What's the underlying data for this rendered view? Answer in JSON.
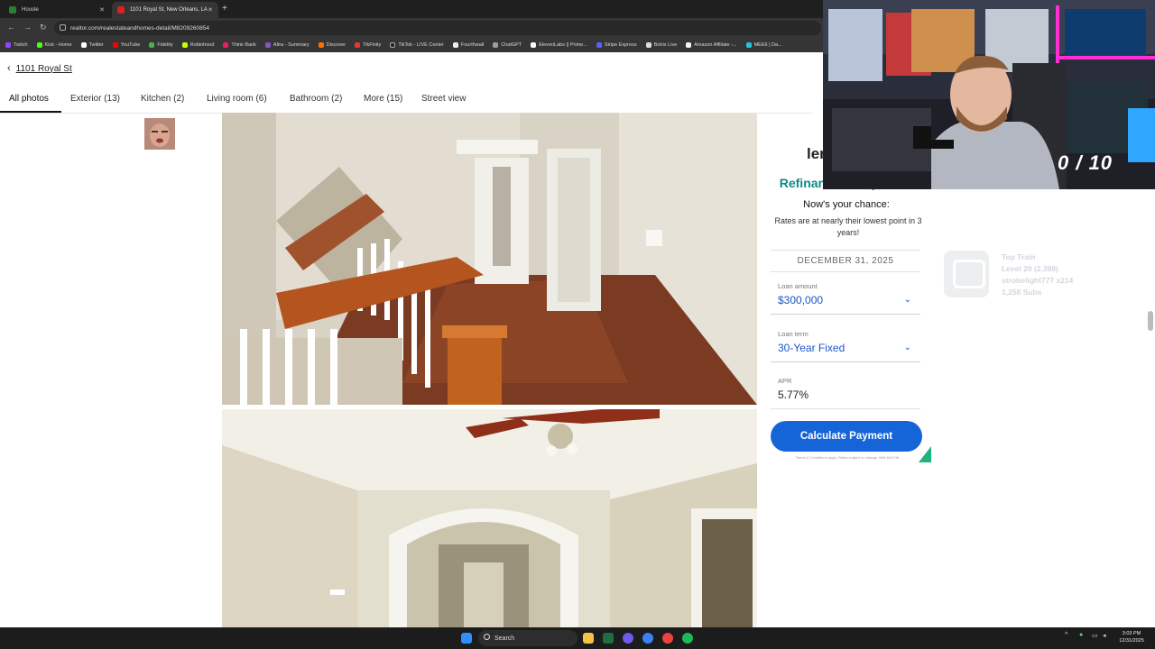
{
  "browser": {
    "tabs": [
      {
        "title": "Housle",
        "active": false
      },
      {
        "title": "1101 Royal St, New Orleans, LA",
        "active": true
      }
    ],
    "url": "realtor.com/realestateandhomes-detail/M8209260854",
    "bookmarks": [
      "Twitch",
      "Kick - Home",
      "Twitter",
      "YouTube",
      "Fidelity",
      "Robinhood",
      "Think Bank",
      "Altra - Summary",
      "Discover",
      "TikFinity",
      "TikTok - LIVE Center",
      "Fourthwall",
      "ChatGPT",
      "ElevenLabs || Prime...",
      "Stripe Express",
      "Botrix Live",
      "Amazon Affiliate -...",
      "MEE6 | Da..."
    ]
  },
  "listing": {
    "back_label": "1101 Royal St",
    "photo_tabs": [
      {
        "label": "All photos",
        "active": true
      },
      {
        "label": "Exterior (13)",
        "active": false
      },
      {
        "label": "Kitchen (2)",
        "active": false
      },
      {
        "label": "Living room (6)",
        "active": false
      },
      {
        "label": "Bathroom (2)",
        "active": false
      },
      {
        "label": "More (15)",
        "active": false
      },
      {
        "label": "Street view",
        "active": false
      }
    ]
  },
  "ad": {
    "brand": "len",
    "headline": "Refinance Comparison",
    "chance": "Now's your chance:",
    "rates_text": "Rates are at nearly their lowest point in 3 years!",
    "date": "DECEMBER 31, 2025",
    "loan_amount_label": "Loan amount",
    "loan_amount_value": "$300,000",
    "loan_term_label": "Loan term",
    "loan_term_value": "30-Year Fixed",
    "apr_label": "APR",
    "apr_value": "5.77%",
    "button_label": "Calculate Payment",
    "terms": "Terms & Conditions apply. Rates subject to change. NMLS#1136"
  },
  "stream": {
    "counter": "0 / 10",
    "top_train": {
      "title": "Top Train",
      "level": "Level 20  (2,398)",
      "user": "strobelight777 x214",
      "subs": "1,258 Subs"
    }
  },
  "taskbar": {
    "search_label": "Search",
    "time": "3:03 PM",
    "date": "12/31/2025"
  },
  "colors": {
    "accent_teal": "#0e8a87",
    "button_blue": "#1565d8",
    "link_blue": "#1a56c7"
  }
}
